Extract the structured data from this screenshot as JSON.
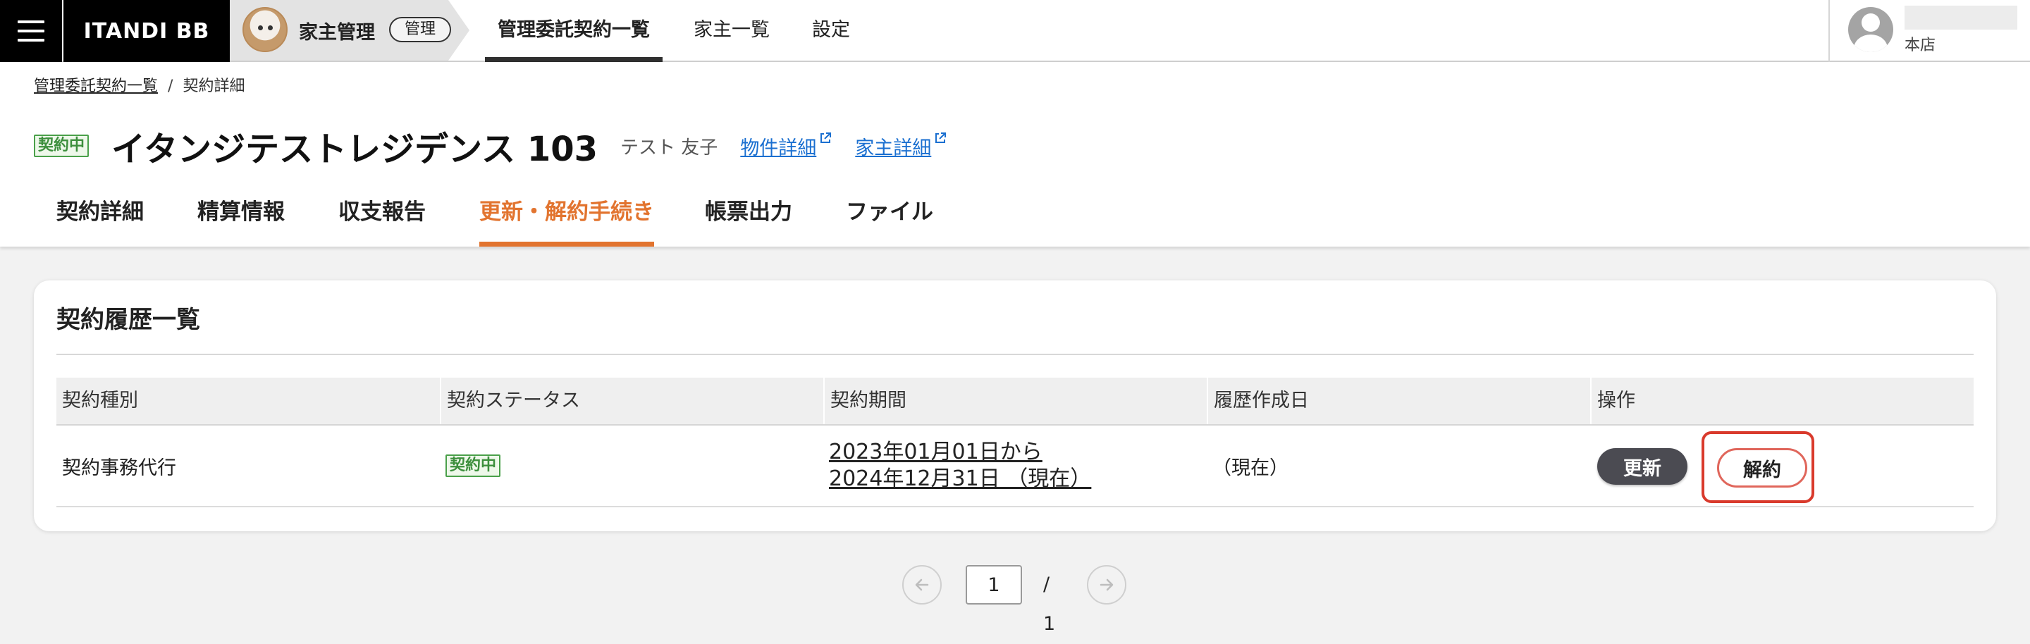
{
  "topbar": {
    "brand": "ITANDI BB",
    "product_title": "家主管理",
    "product_chip": "管理",
    "nav": [
      "管理委託契約一覧",
      "家主一覧",
      "設定"
    ],
    "active_nav": "管理委託契約一覧",
    "user_branch": "本店"
  },
  "breadcrumb": {
    "parent": "管理委託契約一覧",
    "separator": "/",
    "current": "契約詳細"
  },
  "header": {
    "status": "契約中",
    "title": "イタンジテストレジデンス 103",
    "owner": "テスト 友子",
    "links": [
      "物件詳細",
      "家主詳細"
    ]
  },
  "tabs": [
    "契約詳細",
    "精算情報",
    "収支報告",
    "更新・解約手続き",
    "帳票出力",
    "ファイル"
  ],
  "active_tab": "更新・解約手続き",
  "history": {
    "title": "契約履歴一覧",
    "columns": [
      "契約種別",
      "契約ステータス",
      "契約期間",
      "履歴作成日",
      "操作"
    ],
    "rows": [
      {
        "type": "契約事務代行",
        "status": "契約中",
        "period_start": "2023年01月01日から",
        "period_end": "2024年12月31日 （現在）",
        "created": "（現在）",
        "actions": {
          "renew": "更新",
          "cancel": "解約"
        }
      }
    ]
  },
  "pagination": {
    "current": "1",
    "total": "/ 1"
  },
  "colors": {
    "accent_orange": "#e2742f",
    "status_green": "#4aa04a",
    "link_blue": "#1a6fd0",
    "highlight_red": "#d93a2c"
  }
}
